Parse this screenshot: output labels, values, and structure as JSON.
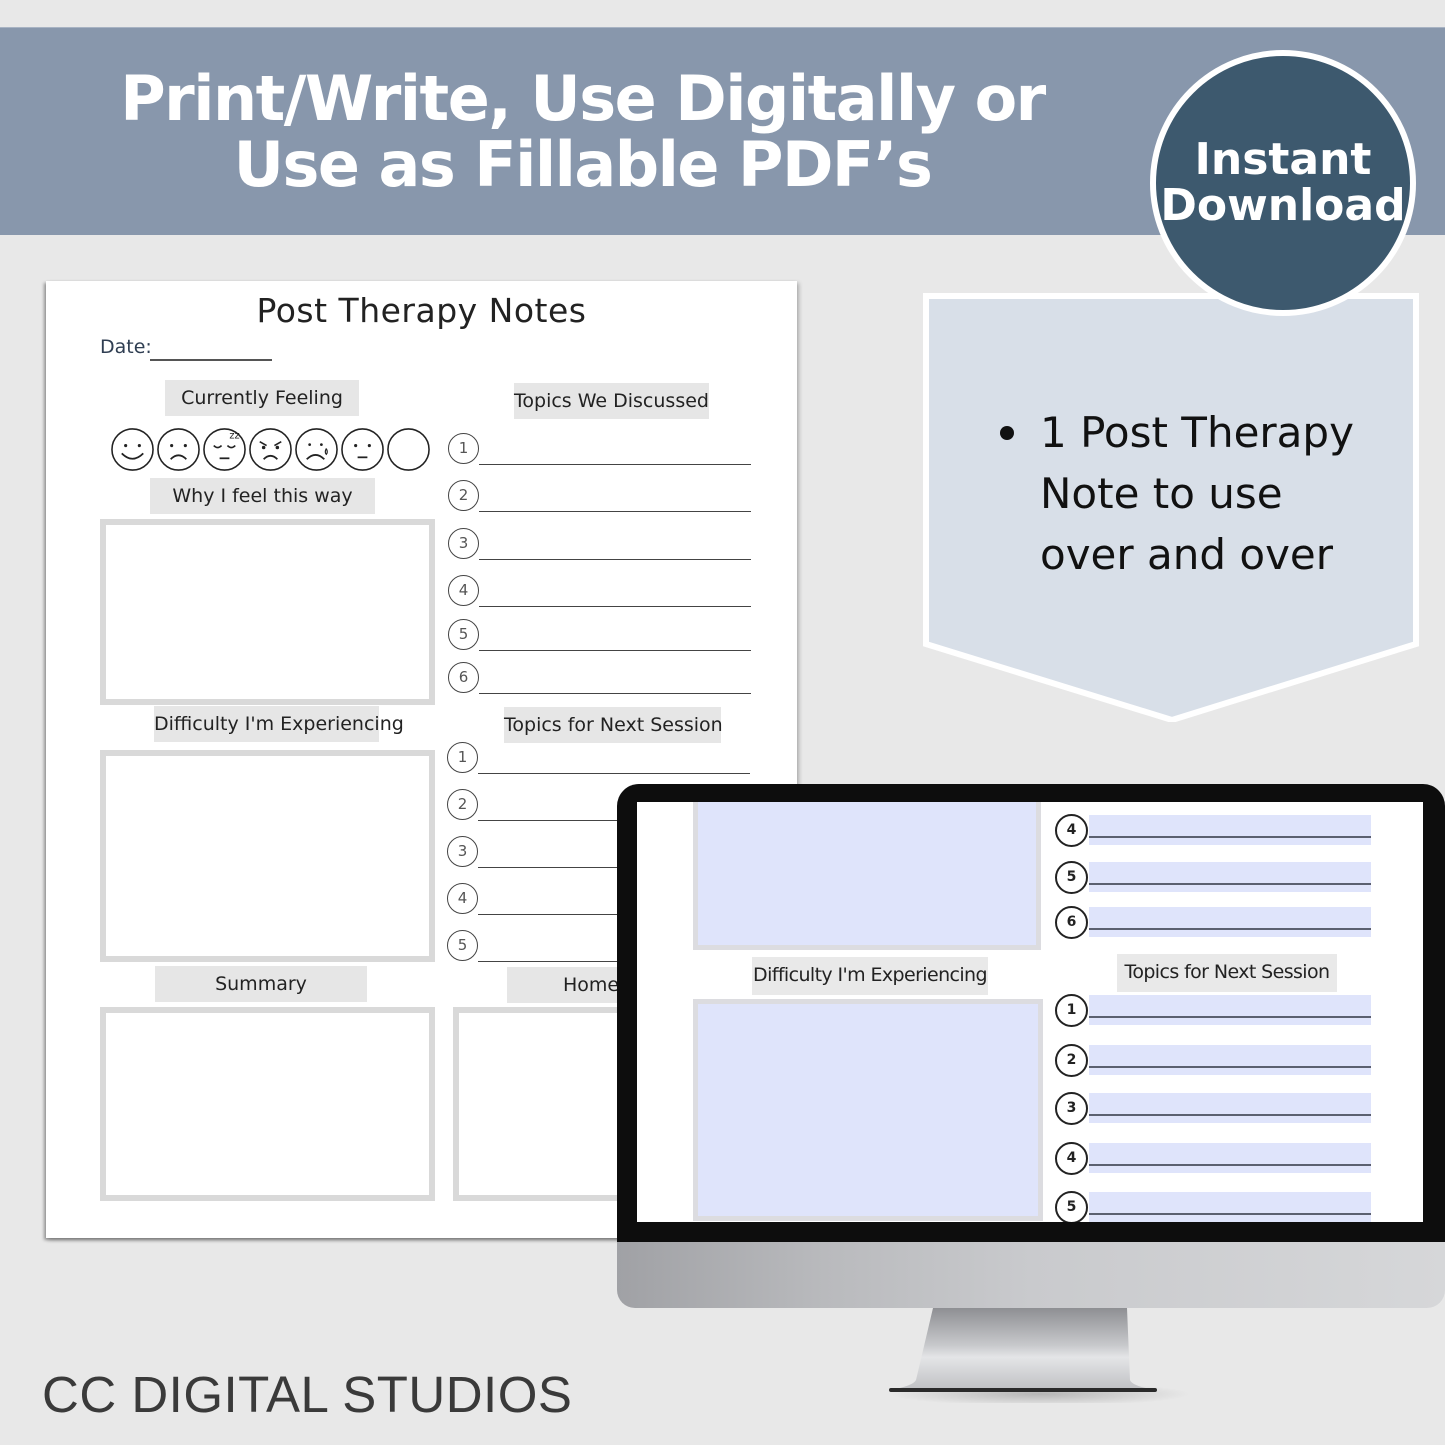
{
  "banner": {
    "title_line1": "Print/Write, Use Digitally or",
    "title_line2": "Use as Fillable PDF’s",
    "background": "#8897ac"
  },
  "badge": {
    "line1": "Instant",
    "line2": "Download",
    "color": "#3d596e"
  },
  "feature": {
    "bullet_lines": [
      "1 Post Therapy",
      "Note to use",
      "over and over"
    ],
    "background": "#d8dfe8"
  },
  "document": {
    "title": "Post Therapy Notes",
    "date_label": "Date:",
    "sections": {
      "currently_feeling": "Currently Feeling",
      "why_feel": "Why I feel this way",
      "difficulty": "Difficulty I'm Experiencing",
      "summary": "Summary",
      "topics_discussed": "Topics We Discussed",
      "topics_next": "Topics for Next Session",
      "homework_partial": "Homew"
    },
    "feelings_icons": [
      "happy-face-icon",
      "sad-face-icon",
      "sleepy-face-icon",
      "angry-face-icon",
      "crying-face-icon",
      "neutral-face-icon",
      "blank-face-icon"
    ],
    "topics_discussed_numbers": [
      "1",
      "2",
      "3",
      "4",
      "5",
      "6"
    ],
    "topics_next_numbers": [
      "1",
      "2",
      "3",
      "4",
      "5"
    ]
  },
  "monitor_screen": {
    "difficulty_label": "Difficulty I'm Experiencing",
    "topics_next_label": "Topics for Next Session",
    "upper_numbers": [
      "4",
      "5",
      "6"
    ],
    "lower_numbers": [
      "1",
      "2",
      "3",
      "4",
      "5"
    ],
    "field_color": "#dfe4fb"
  },
  "footer": {
    "brand": "CC DIGITAL STUDIOS"
  }
}
